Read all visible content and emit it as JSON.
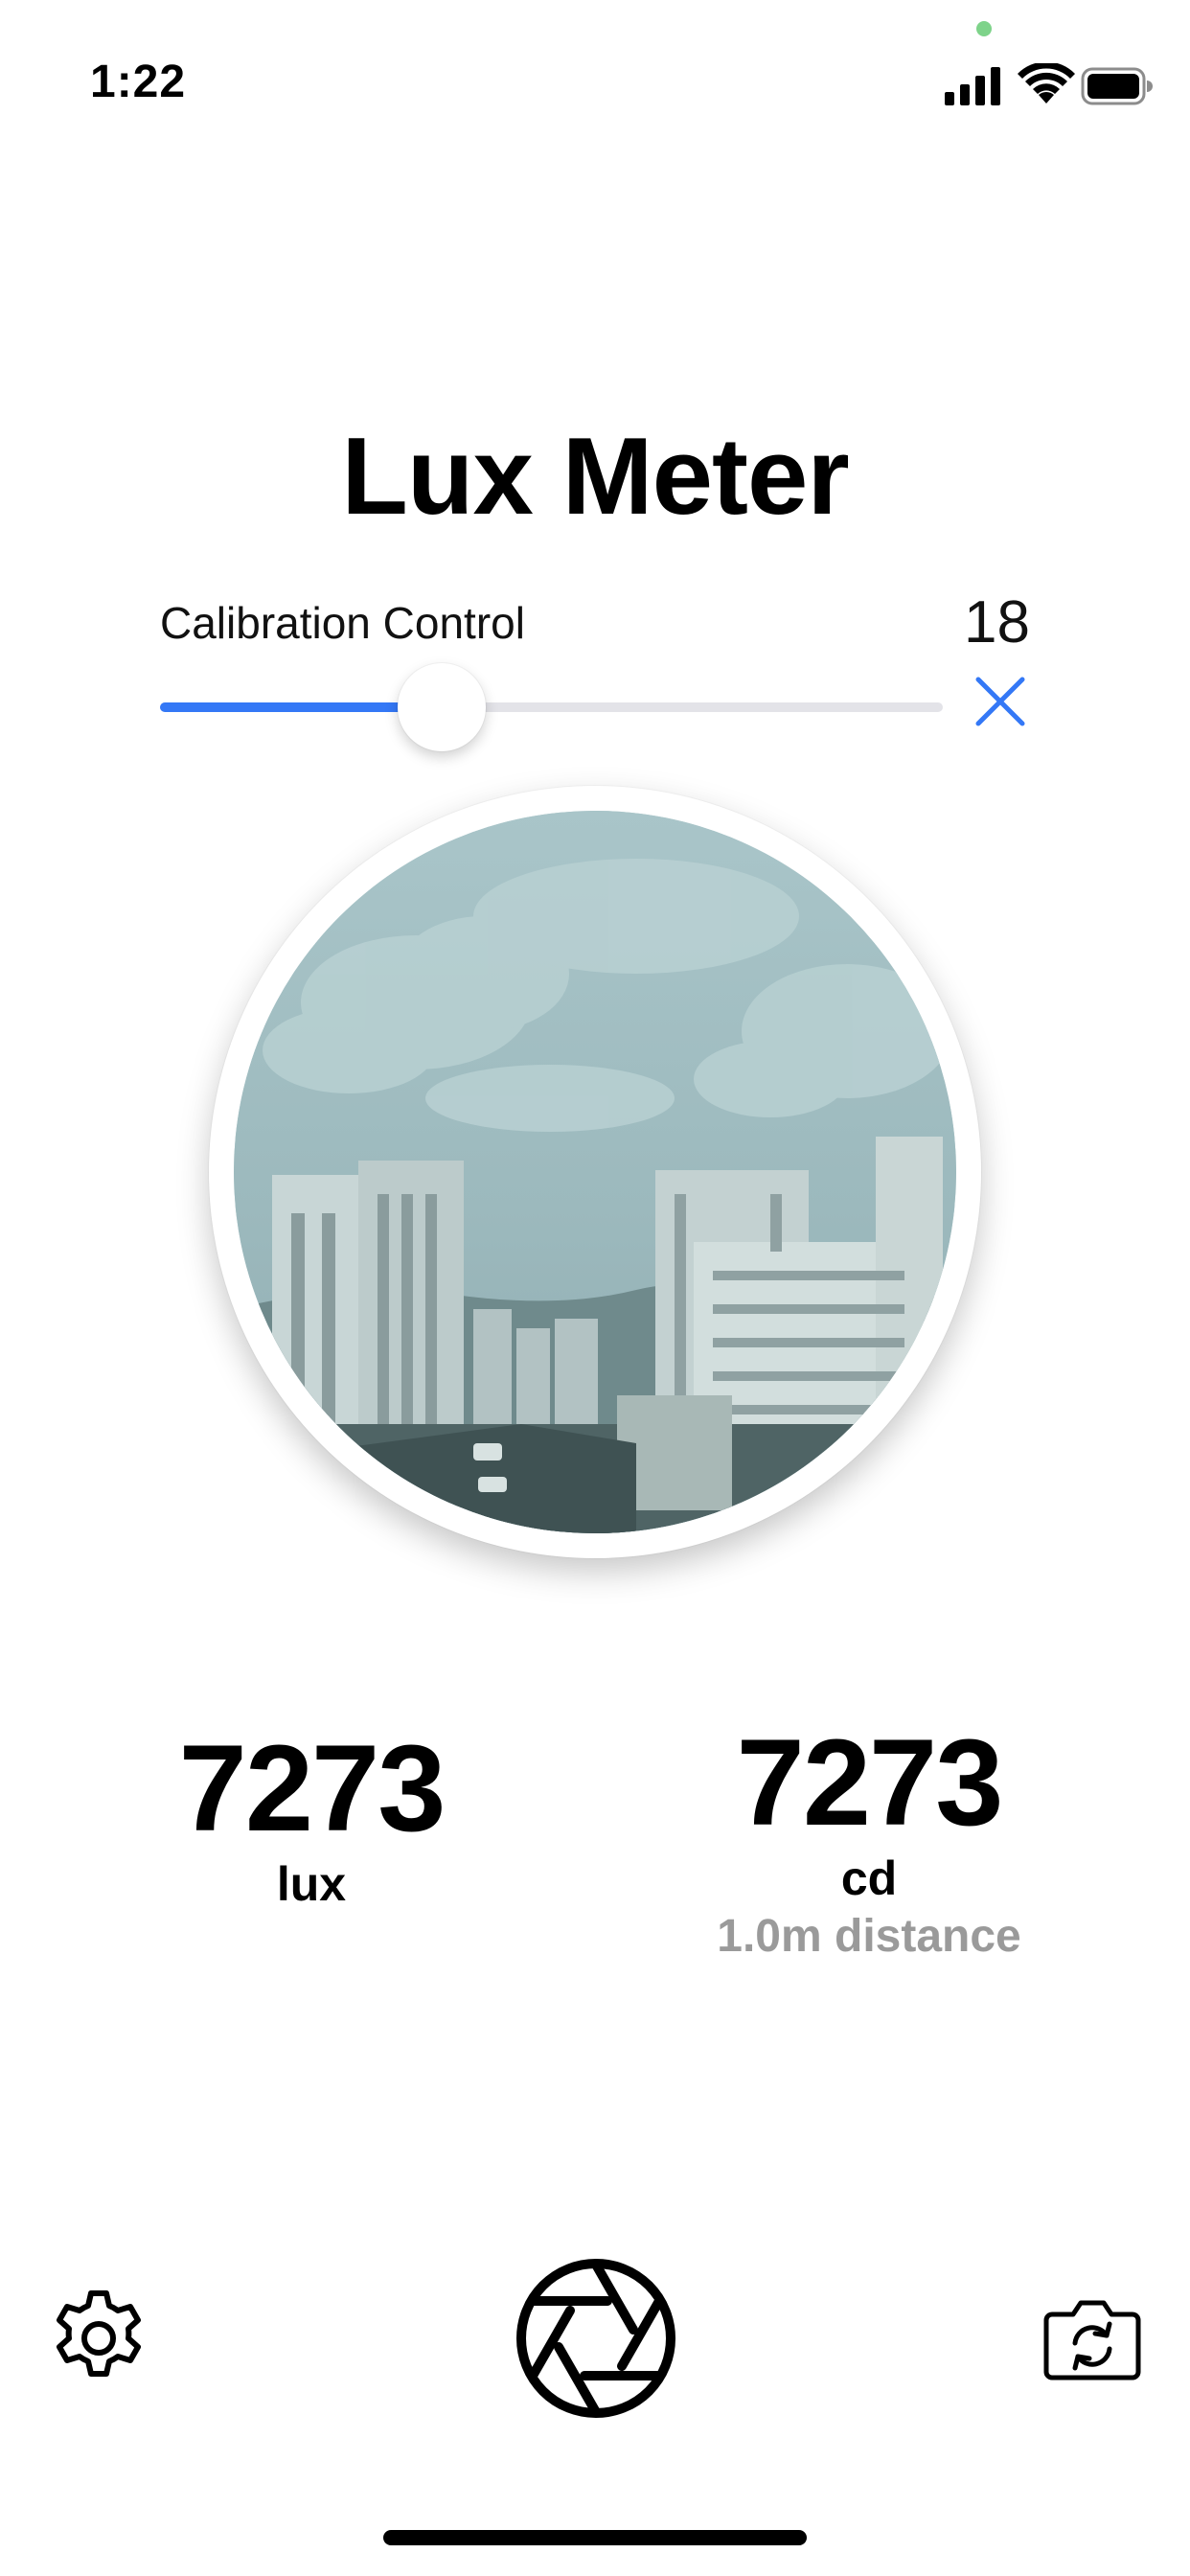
{
  "status_bar": {
    "time": "1:22",
    "icons": [
      "cellular-signal-icon",
      "wifi-icon",
      "battery-icon"
    ],
    "mic_indicator_color": "#7ed38a"
  },
  "app": {
    "title": "Lux Meter"
  },
  "calibration": {
    "label": "Calibration Control",
    "value": "18",
    "slider_fraction": 0.36,
    "accent_color": "#3478f6",
    "close_icon": "close-icon"
  },
  "camera": {
    "preview_description_icon": "camera-preview"
  },
  "readings": {
    "lux": {
      "value": "7273",
      "unit": "lux"
    },
    "cd": {
      "value": "7273",
      "unit": "cd",
      "distance": "1.0m distance"
    }
  },
  "toolbar": {
    "settings_icon": "gear-icon",
    "shutter_icon": "aperture-icon",
    "flip_icon": "camera-flip-icon"
  }
}
